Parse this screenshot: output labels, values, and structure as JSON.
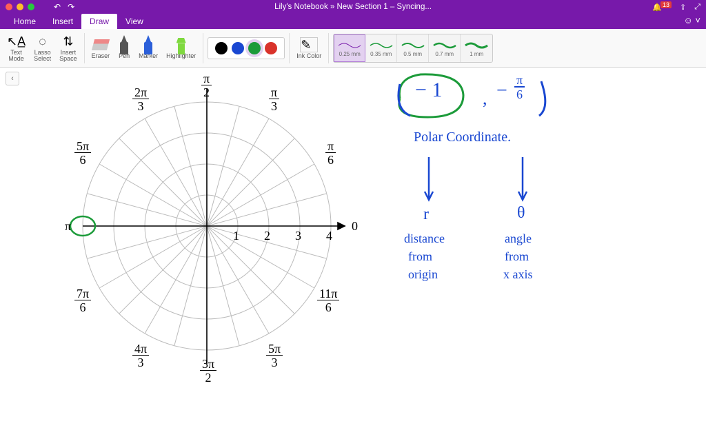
{
  "title": {
    "notebook": "Lily's Notebook",
    "sep": "»",
    "section": "New Section 1 – Syncing..."
  },
  "topright": {
    "notif_count": "13"
  },
  "menu": {
    "home": "Home",
    "insert": "Insert",
    "draw": "Draw",
    "view": "View"
  },
  "ribbon": {
    "text_mode": "Text\nMode",
    "lasso": "Lasso\nSelect",
    "insert_space": "Insert\nSpace",
    "eraser": "Eraser",
    "pen": "Pen",
    "marker": "Marker",
    "highlighter": "Highlighter",
    "ink_color": "Ink Color",
    "thickness": [
      "0.25 mm",
      "0.35 mm",
      "0.5 mm",
      "0.7 mm",
      "1 mm"
    ]
  },
  "polar": {
    "angles_num": [
      "π",
      "2π",
      "π",
      "π",
      "π",
      "0",
      "π",
      "11π",
      "5π",
      "3π",
      "4π",
      "7π",
      "π",
      "5π"
    ],
    "angles_den": [
      "2",
      "3",
      "3",
      "6",
      "6",
      "",
      "",
      "6",
      "3",
      "2",
      "3",
      "6",
      "",
      ""
    ],
    "pi_label": "π",
    "zero_label": "0",
    "radii": [
      "1",
      "2",
      "3",
      "4"
    ]
  },
  "hand": {
    "coord_left": "− 1",
    "coord_right_num": "π",
    "coord_right_den": "6",
    "coord_neg": "−",
    "paren_l": "(",
    "paren_r": ")",
    "heading": "Polar Coordinate.",
    "r": "r",
    "theta": "θ",
    "r_desc1": "distance",
    "r_desc2": "from",
    "r_desc3": "origin",
    "t_desc1": "angle",
    "t_desc2": "from",
    "t_desc3": "x axis"
  }
}
